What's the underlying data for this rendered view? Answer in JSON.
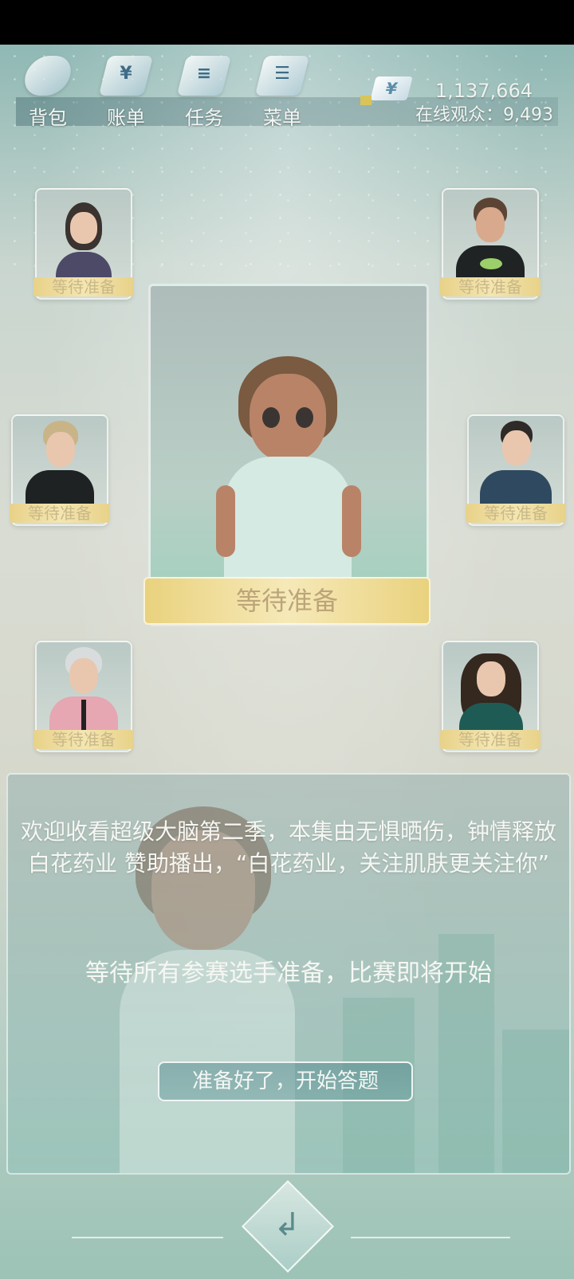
{
  "menu": {
    "items": [
      {
        "label": "背包",
        "icon": "backpack-icon",
        "glyph": ""
      },
      {
        "label": "账单",
        "icon": "bill-icon",
        "glyph": "¥"
      },
      {
        "label": "任务",
        "icon": "task-icon",
        "glyph": "≡"
      },
      {
        "label": "菜单",
        "icon": "menu-icon",
        "glyph": "☰"
      }
    ]
  },
  "stats": {
    "currency_symbol": "¥",
    "money": "1,137,664",
    "viewers": "在线观众：9,493"
  },
  "contestants": {
    "status_label": "等待准备"
  },
  "main_player": {
    "status_label": "等待准备"
  },
  "panel": {
    "welcome_text": "欢迎收看超级大脑第二季，本集由无惧晒伤，钟情释放 白花药业 赞助播出，“白花药业，关注肌肤更关注你”",
    "waiting_text": "等待所有参赛选手准备，比赛即将开始",
    "ready_button": "准备好了，开始答题"
  },
  "colors": {
    "tag_gold": "#e8d289",
    "scene_bg": "#d6d8cc",
    "panel_teal": "#96c3b9"
  }
}
